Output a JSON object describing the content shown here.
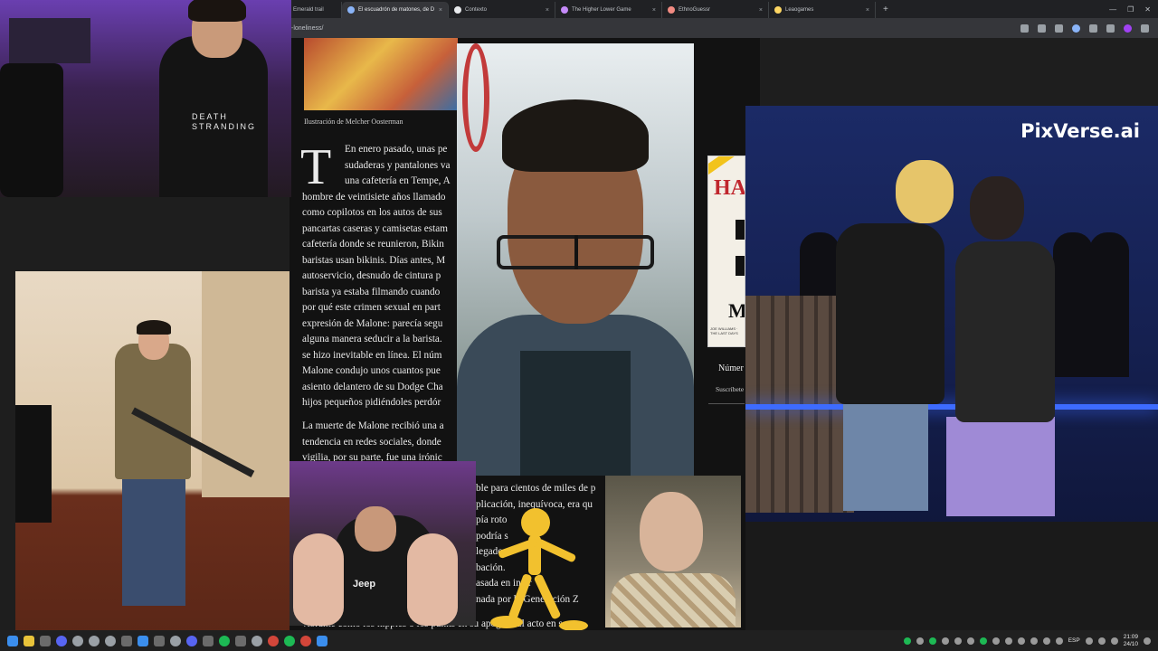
{
  "browser": {
    "tabs": [
      {
        "label": "Emerald trail",
        "active": false
      },
      {
        "label": "El escuadrón de matones, de D",
        "active": true
      },
      {
        "label": "Contexto",
        "active": false
      },
      {
        "label": "The Higher Lower Game",
        "active": false
      },
      {
        "label": "EthnoGuessr",
        "active": false
      },
      {
        "label": "Leaogames",
        "active": false
      }
    ],
    "new_tab": "+",
    "tab_close": "×",
    "url": "-loneliness/",
    "window_controls": [
      "—",
      "❐",
      "✕"
    ]
  },
  "article": {
    "illustration_caption": "Ilustración de Melcher Oosterman",
    "drop_cap": "T",
    "para1_lines": [
      "En enero pasado, unas pe",
      "sudaderas y pantalones va",
      "una cafetería en Tempe, A",
      "hombre de veintisiete años llamado",
      "como copilotos en los autos de sus",
      "pancartas caseras y camisetas estam",
      "cafetería donde se reunieron, Bikin",
      "baristas usan bikinis. Días antes, M",
      "autoservicio, desnudo de cintura p",
      "barista ya estaba filmando cuando",
      "por qué este crimen sexual en part",
      "expresión de Malone: parecía segu",
      "alguna manera seducir a la barista.",
      "se hizo inevitable en línea. El núm",
      "Malone condujo unos cuantos pue",
      "asiento delantero de su Dodge Cha",
      "hijos pequeños pidiéndoles perdór"
    ],
    "para2_lines": [
      "La muerte de Malone recibió una a",
      "tendencia en redes sociales, donde",
      "vigilia, por su parte, fue una irónic"
    ],
    "lower_lines": [
      "ble para cientos de miles de p",
      "plicación, inequívoca, era qu",
      "pía roto",
      "podría s",
      "legado —",
      "bación.",
      "asada en inter",
      "nada por la Generación Z",
      "vibrante como los hippies o los punks en su apogeo. El acto en s"
    ],
    "side_number": "Númer",
    "side_subscribe": "Suscríbete"
  },
  "book": {
    "title_top": "HA",
    "title_bottom": "M",
    "author": "JOE WILLIAMS · THE LAST DAYS"
  },
  "overlays": {
    "pixverse_logo": "PixVerse.ai",
    "shirt_text": "DEATH STRANDING",
    "jersey_text": "Jeep"
  },
  "taskbar": {
    "lang": "ESP",
    "time": "21:09",
    "date": "24/10"
  }
}
